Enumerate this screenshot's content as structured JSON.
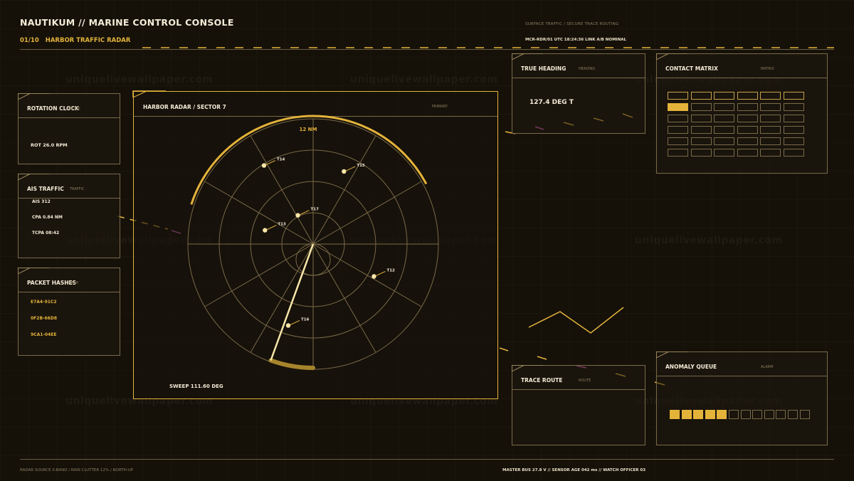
{
  "header": {
    "title": "NAUTIKUM // MARINE CONTROL CONSOLE",
    "section_number": "01/10",
    "section_title": "HARBOR TRAFFIC RADAR",
    "context": "SURFACE TRAFFIC / SECURE TRACE ROUTING",
    "status_line": "MCR-RDR/01   UTC 18:24:36   LINK A/B NOMINAL"
  },
  "footer": {
    "left": "RADAR SOURCE X-BAND / RAIN CLUTTER 12% / NORTH-UP",
    "right": "MASTER BUS 27.8 V  //  SENSOR AGE 042 ms  //  WATCH OFFICER 03"
  },
  "panels": {
    "rotation": {
      "title": "ROTATION CLOCK",
      "tag": "CLOCK",
      "value": "ROT 26.0 RPM"
    },
    "ais": {
      "title": "AIS TRAFFIC",
      "tag": "TRAFFIC",
      "lines": [
        "AIS 312",
        "CPA 0.84 NM",
        "TCPA 08:42"
      ]
    },
    "hashes": {
      "title": "PACKET HASHES",
      "tag": "HASH",
      "items": [
        "E7A4-91C2",
        "0F2B-66D8",
        "9CA1-04EE"
      ]
    },
    "heading": {
      "title": "TRUE HEADING",
      "tag": "HEADING",
      "value": "127.4 DEG T"
    },
    "matrix": {
      "title": "CONTACT MATRIX",
      "tag": "MATRIX",
      "rows": 6,
      "cols": 6,
      "highlighted": [
        [
          1,
          0
        ]
      ]
    },
    "trace": {
      "title": "TRACE ROUTE",
      "tag": "ROUTE"
    },
    "anomaly": {
      "title": "ANOMALY QUEUE",
      "tag": "ALARM",
      "total": 12,
      "active": 5
    }
  },
  "radar": {
    "title": "HARBOR RADAR / SECTOR 7",
    "tag": "PRIMARY",
    "range_label": "12 NM",
    "sweep_readout": "SWEEP 111.60 DEG",
    "targets": [
      {
        "id": "T14",
        "range": 0.74,
        "bearing": 328
      },
      {
        "id": "T15",
        "range": 0.63,
        "bearing": 23
      },
      {
        "id": "T17",
        "range": 0.26,
        "bearing": 332
      },
      {
        "id": "T13",
        "range": 0.4,
        "bearing": 286
      },
      {
        "id": "T12",
        "range": 0.55,
        "bearing": 118
      },
      {
        "id": "T16",
        "range": 0.68,
        "bearing": 197
      }
    ]
  },
  "colors": {
    "accent": "#e4b33a",
    "pale": "#f7e6a8",
    "magenta": "#e05fb5",
    "line": "#7a6a48"
  },
  "watermark": "uniquelivewallpaper.com"
}
